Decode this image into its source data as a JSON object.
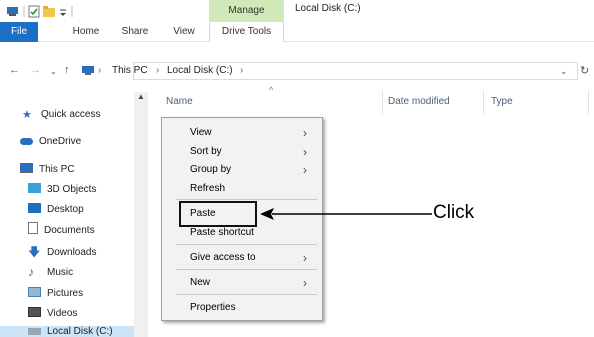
{
  "titlebar": {
    "manage_label": "Manage",
    "window_title": "Local Disk (C:)"
  },
  "ribbon": {
    "tabs": [
      {
        "label": "File"
      },
      {
        "label": "Home"
      },
      {
        "label": "Share"
      },
      {
        "label": "View"
      },
      {
        "label": "Drive Tools"
      }
    ]
  },
  "address": {
    "segments": [
      "This PC",
      "Local Disk (C:)"
    ]
  },
  "nav_pane": {
    "items": [
      {
        "label": "Quick access",
        "icon": "star-icon"
      },
      {
        "label": "OneDrive",
        "icon": "cloud-icon"
      },
      {
        "label": "This PC",
        "icon": "monitor-icon"
      },
      {
        "label": "3D Objects",
        "icon": "cube-icon"
      },
      {
        "label": "Desktop",
        "icon": "desktop-icon"
      },
      {
        "label": "Documents",
        "icon": "document-icon"
      },
      {
        "label": "Downloads",
        "icon": "download-icon"
      },
      {
        "label": "Music",
        "icon": "music-icon"
      },
      {
        "label": "Pictures",
        "icon": "pictures-icon"
      },
      {
        "label": "Videos",
        "icon": "video-icon"
      },
      {
        "label": "Local Disk (C:)",
        "icon": "drive-icon"
      }
    ]
  },
  "columns": [
    "Name",
    "Date modified",
    "Type"
  ],
  "context_menu": {
    "items": [
      {
        "label": "View",
        "submenu": true
      },
      {
        "label": "Sort by",
        "submenu": true
      },
      {
        "label": "Group by",
        "submenu": true
      },
      {
        "label": "Refresh",
        "submenu": false
      },
      {
        "label": "Paste",
        "submenu": false
      },
      {
        "label": "Paste shortcut",
        "submenu": false
      },
      {
        "label": "Give access to",
        "submenu": true
      },
      {
        "label": "New",
        "submenu": true
      },
      {
        "label": "Properties",
        "submenu": false
      }
    ]
  },
  "annotation": {
    "callout": "Click"
  },
  "colors": {
    "accent": "#1a6fc7",
    "manage_tab": "#cfe9b9",
    "selection": "#cce4f7",
    "menu_bg": "#f2f2f2"
  }
}
